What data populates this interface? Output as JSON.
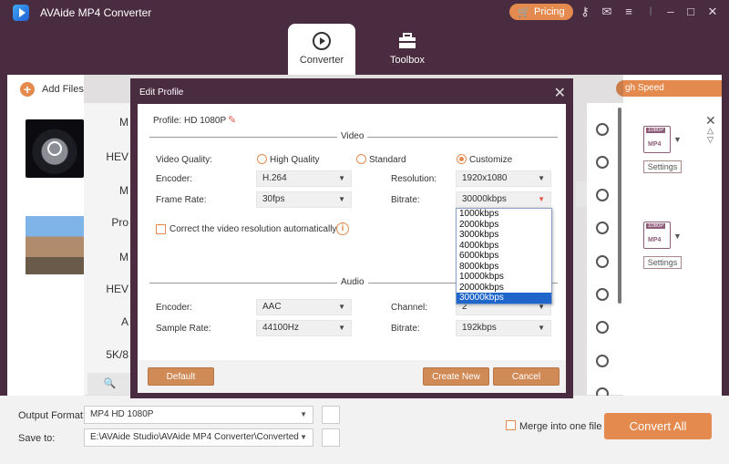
{
  "app": {
    "title": "AVAide MP4 Converter",
    "pricing_label": "Pricing",
    "accent": "#e58a4e",
    "chrome": "#4a2c40"
  },
  "tabs": [
    {
      "label": "Converter",
      "icon": "converter-icon",
      "active": true
    },
    {
      "label": "Toolbox",
      "icon": "toolbox-icon",
      "active": false
    }
  ],
  "toolbar": {
    "add_files": "Add Files",
    "high_speed": "gh Speed Conversion"
  },
  "profile_list": {
    "items": [
      "M",
      "HEV",
      "M",
      "Pro",
      "M",
      "HEV",
      "A",
      "5K/8"
    ]
  },
  "file_rows": [
    {
      "format_tag": "1080P",
      "format": "MP4",
      "settings_label": "Settings"
    },
    {
      "format_tag": "1080P",
      "format": "MP4",
      "settings_label": "Settings"
    }
  ],
  "dialog": {
    "title": "Edit Profile",
    "profile_label": "Profile:",
    "profile_name": "HD 1080P",
    "video_section": "Video",
    "audio_section": "Audio",
    "video_quality": {
      "label": "Video Quality:",
      "options": [
        "High Quality",
        "Standard",
        "Customize"
      ],
      "selected": "Customize"
    },
    "encoder": {
      "label": "Encoder:",
      "value": "H.264"
    },
    "resolution": {
      "label": "Resolution:",
      "value": "1920x1080"
    },
    "frame_rate": {
      "label": "Frame Rate:",
      "value": "30fps"
    },
    "bitrate": {
      "label": "Bitrate:",
      "value": "30000kbps"
    },
    "correct_resolution": "Correct the video resolution automatically.",
    "bitrate_options": [
      "1000kbps",
      "2000kbps",
      "3000kbps",
      "4000kbps",
      "6000kbps",
      "8000kbps",
      "10000kbps",
      "20000kbps",
      "30000kbps"
    ],
    "audio_encoder": {
      "label": "Encoder:",
      "value": "AAC"
    },
    "channel": {
      "label": "Channel:",
      "value": "2"
    },
    "sample_rate": {
      "label": "Sample Rate:",
      "value": "44100Hz"
    },
    "audio_bitrate": {
      "label": "Bitrate:",
      "value": "192kbps"
    },
    "default_btn": "Default",
    "create_new_btn": "Create New",
    "cancel_btn": "Cancel"
  },
  "bottom": {
    "output_format_label": "Output Format:",
    "output_format_value": "MP4 HD 1080P",
    "save_to_label": "Save to:",
    "save_to_value": "E:\\AVAide Studio\\AVAide MP4 Converter\\Converted",
    "merge_label": "Merge into one file",
    "convert_all": "Convert All"
  }
}
